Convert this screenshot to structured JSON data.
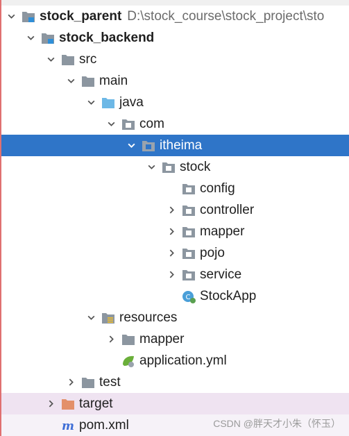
{
  "tree": {
    "root": {
      "label": "stock_parent",
      "path": "D:\\stock_course\\stock_project\\sto"
    },
    "module": {
      "label": "stock_backend"
    },
    "src": {
      "label": "src"
    },
    "main": {
      "label": "main"
    },
    "java": {
      "label": "java"
    },
    "com": {
      "label": "com"
    },
    "itheima": {
      "label": "itheima"
    },
    "stock": {
      "label": "stock"
    },
    "config": {
      "label": "config"
    },
    "controller": {
      "label": "controller"
    },
    "mapper": {
      "label": "mapper"
    },
    "pojo": {
      "label": "pojo"
    },
    "service": {
      "label": "service"
    },
    "stockapp": {
      "label": "StockApp"
    },
    "resources": {
      "label": "resources"
    },
    "res_mapper": {
      "label": "mapper"
    },
    "application_yml": {
      "label": "application.yml"
    },
    "test": {
      "label": "test"
    },
    "target": {
      "label": "target"
    },
    "pom": {
      "label": "pom.xml"
    }
  },
  "watermark": "CSDN @胖天才小朱（怀玉）",
  "colors": {
    "selection": "#2f75c8",
    "folder": "#8c96a0",
    "source_folder": "#6db8e6",
    "excluded_folder": "#e3906a",
    "excluded_row": "#efe3f1"
  },
  "icons": {
    "folder": "folder-icon",
    "package": "package-icon",
    "module": "module-icon",
    "source": "source-folder-icon",
    "resources": "resources-folder-icon",
    "excluded": "excluded-folder-icon",
    "spring_class": "spring-boot-class-icon",
    "spring_yml": "spring-yml-icon",
    "maven": "maven-icon"
  }
}
